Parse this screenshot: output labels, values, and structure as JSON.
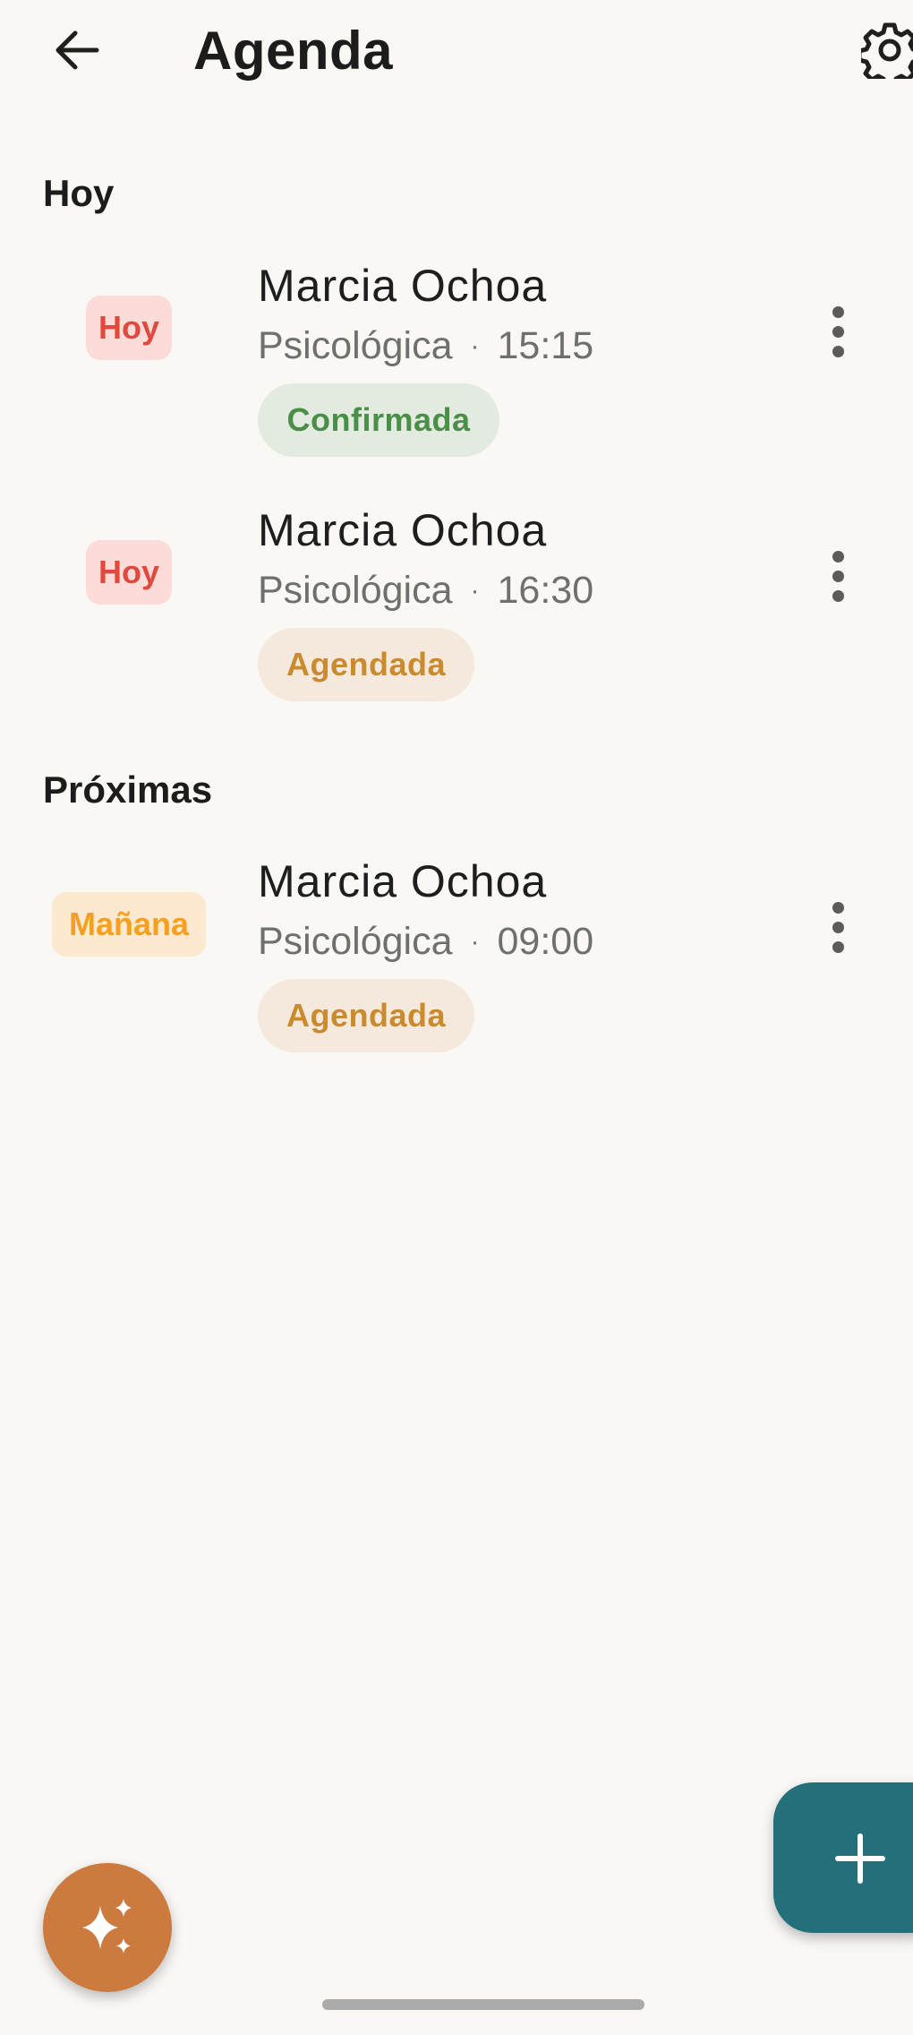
{
  "header": {
    "title": "Agenda"
  },
  "sections": [
    {
      "title": "Hoy",
      "appointments": [
        {
          "date_chip": "Hoy",
          "name": "Marcia Ochoa",
          "type": "Psicológica",
          "time": "15:15",
          "status": "Confirmada"
        },
        {
          "date_chip": "Hoy",
          "name": "Marcia Ochoa",
          "type": "Psicológica",
          "time": "16:30",
          "status": "Agendada"
        }
      ]
    },
    {
      "title": "Próximas",
      "appointments": [
        {
          "date_chip": "Mañana",
          "name": "Marcia Ochoa",
          "type": "Psicológica",
          "time": "09:00",
          "status": "Agendada"
        }
      ]
    }
  ],
  "meta_separator": "·",
  "icons": {
    "back": "arrow-left-icon",
    "settings": "gear-icon",
    "more": "more-vert-icon",
    "add": "plus-icon",
    "ai": "sparkles-icon"
  },
  "colors": {
    "background": "#f9f8f5",
    "fab_add": "#23707a",
    "fab_ai": "#cc7a3d",
    "chip_today_bg": "#fbdcd9",
    "chip_today_text": "#e0493e",
    "chip_tomorrow_bg": "#fde9cf",
    "chip_tomorrow_text": "#f5a021",
    "status_confirmed_bg": "#e3eae0",
    "status_confirmed_text": "#4a8f48",
    "status_scheduled_bg": "#f4e9dc",
    "status_scheduled_text": "#c98b2e"
  }
}
